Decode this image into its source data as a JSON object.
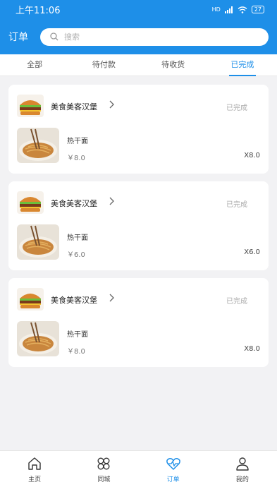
{
  "status_bar": {
    "time": "上午11:06",
    "signal": "HD",
    "battery": "27"
  },
  "header": {
    "title": "订单",
    "search_placeholder": "搜索"
  },
  "tabs": [
    {
      "label": "全部",
      "active": false
    },
    {
      "label": "待付款",
      "active": false
    },
    {
      "label": "待收货",
      "active": false
    },
    {
      "label": "已完成",
      "active": true
    }
  ],
  "orders": [
    {
      "shop_name": "美食美客汉堡",
      "status": "已完成",
      "item_name": "热干面",
      "price": "￥8.0",
      "quantity": "X8.0"
    },
    {
      "shop_name": "美食美客汉堡",
      "status": "已完成",
      "item_name": "热干面",
      "price": "￥6.0",
      "quantity": "X6.0"
    },
    {
      "shop_name": "美食美客汉堡",
      "status": "已完成",
      "item_name": "热干面",
      "price": "￥8.0",
      "quantity": "X8.0"
    }
  ],
  "bottom_nav": [
    {
      "label": "主页",
      "icon": "home-icon",
      "active": false
    },
    {
      "label": "同城",
      "icon": "grid-icon",
      "active": false
    },
    {
      "label": "订单",
      "icon": "heart-pulse-icon",
      "active": true
    },
    {
      "label": "我的",
      "icon": "user-icon",
      "active": false
    }
  ],
  "colors": {
    "primary": "#1e8fe8",
    "background": "#f2f2f4"
  }
}
